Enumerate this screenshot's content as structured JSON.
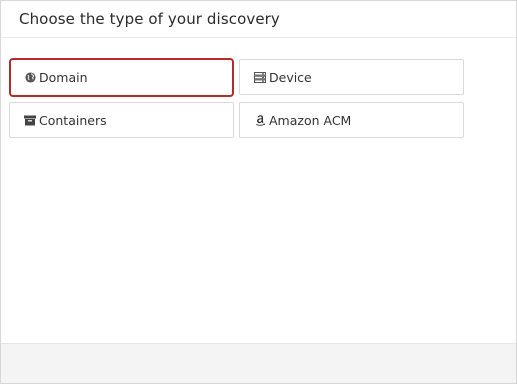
{
  "dialog": {
    "title": "Choose the type of your discovery"
  },
  "options": [
    {
      "label": "Domain",
      "icon": "globe-icon",
      "selected": true
    },
    {
      "label": "Device",
      "icon": "server-icon",
      "selected": false
    },
    {
      "label": "Containers",
      "icon": "archive-box-icon",
      "selected": false
    },
    {
      "label": "Amazon ACM",
      "icon": "amazon-icon",
      "selected": false
    }
  ],
  "colors": {
    "selected_border": "#b52a2a",
    "footer_bg": "#f4f4f4"
  }
}
